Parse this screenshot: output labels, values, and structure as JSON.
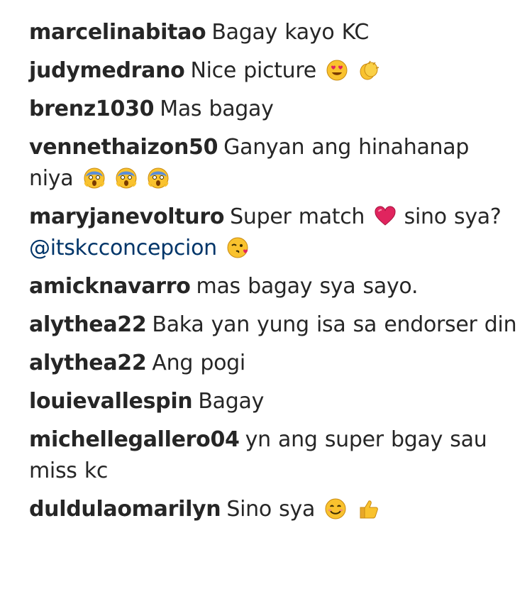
{
  "comments": [
    {
      "username": "marcelinabitao",
      "text": "Bagay kayo KC"
    },
    {
      "username": "judymedrano",
      "text": "Nice picture",
      "emojis": [
        "heart-eyes-emoji",
        "clapping-hands-emoji"
      ]
    },
    {
      "username": "brenz1030",
      "text": "Mas bagay"
    },
    {
      "username": "vennethaizon50",
      "text": "Ganyan ang hinahanap niya",
      "emojis": [
        "screaming-face-emoji",
        "screaming-face-emoji",
        "screaming-face-emoji"
      ]
    },
    {
      "username": "maryjanevolturo",
      "text": "Super match",
      "emoji_mid": "beating-heart-emoji",
      "text_after": "sino sya?",
      "mention": "@itskcconcepcion",
      "emojis": [
        "kissing-wink-face-emoji"
      ]
    },
    {
      "username": "amicknavarro",
      "text": "mas bagay sya sayo."
    },
    {
      "username": "alythea22",
      "text": "Baka yan yung isa sa endorser din"
    },
    {
      "username": "alythea22",
      "text": "Ang pogi"
    },
    {
      "username": "louievallespin",
      "text": "Bagay"
    },
    {
      "username": "michellegallero04",
      "text": "yn ang super bgay sau miss kc"
    },
    {
      "username": "duldulaomarilyn",
      "text": "Sino sya",
      "emojis": [
        "smiling-face-emoji",
        "thumbs-up-emoji"
      ]
    }
  ],
  "colors": {
    "text": "#262626",
    "mention": "#003569",
    "emoji_yellow": "#F9C22E",
    "heart_red": "#E0245E"
  }
}
